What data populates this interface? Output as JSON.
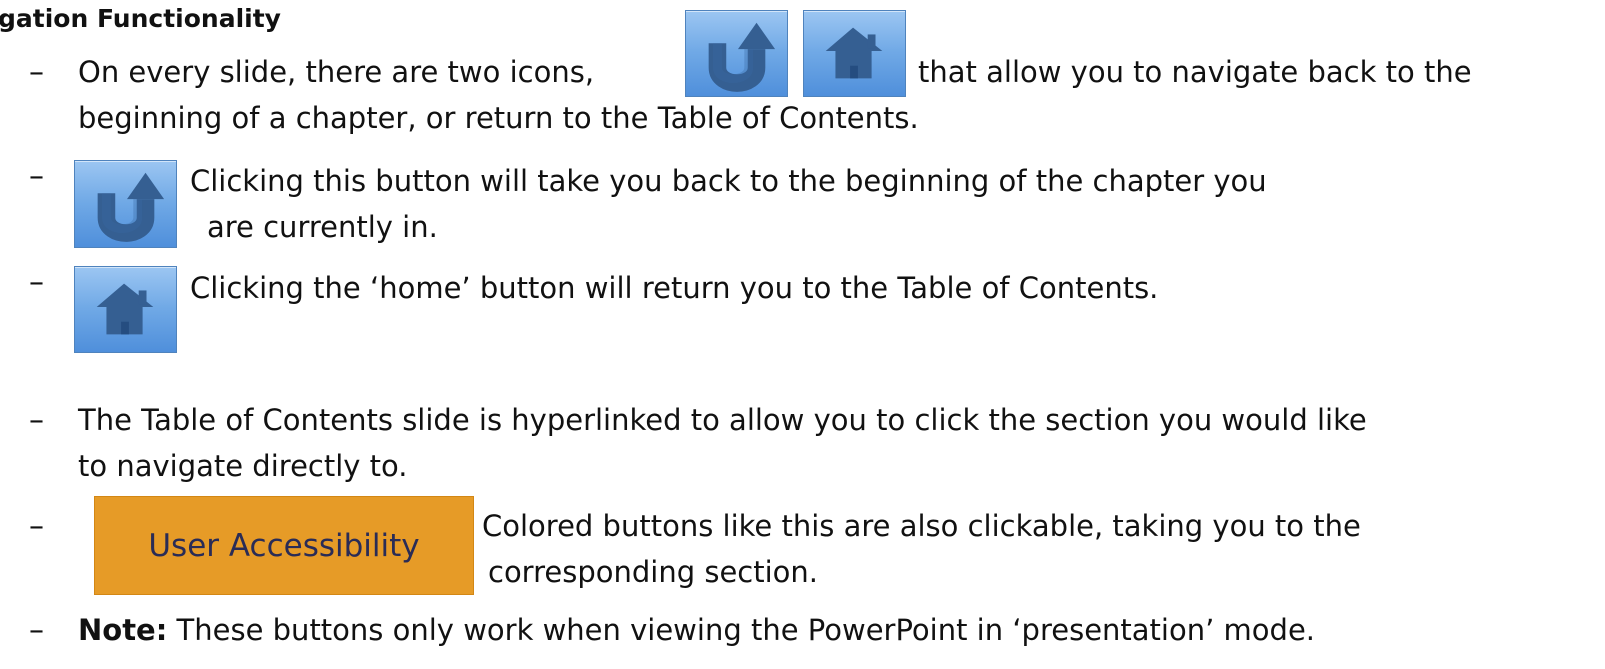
{
  "heading": "gation Functionality",
  "bullets": [
    {
      "line1": "On every slide, there are two icons,",
      "line1b": "that allow you to navigate back to the",
      "line2": "beginning of a chapter, or return to the Table of Contents."
    },
    {
      "line1": "Clicking this button will take you back to the beginning of the chapter you",
      "line2": "are currently in."
    },
    {
      "line1": "Clicking the ‘home’ button will return you to the Table of Contents."
    },
    {
      "line1": "The Table of Contents slide is hyperlinked to allow you to click the section you would like",
      "line2": "to navigate directly to."
    },
    {
      "button_label": "User Accessibility",
      "line1": "Colored buttons like this are also clickable, taking you to the",
      "line2": "corresponding section."
    },
    {
      "note_label": "Note:",
      "line1": " These buttons only work when viewing the PowerPoint in ‘presentation’ mode."
    }
  ],
  "icons": {
    "back": "return-to-chapter-start-icon",
    "home": "home-icon"
  },
  "colors": {
    "icon_blue": "#6fa7e7",
    "icon_dark_blue": "#355f92",
    "button_orange": "#e69b27",
    "button_text": "#2a2c56"
  }
}
